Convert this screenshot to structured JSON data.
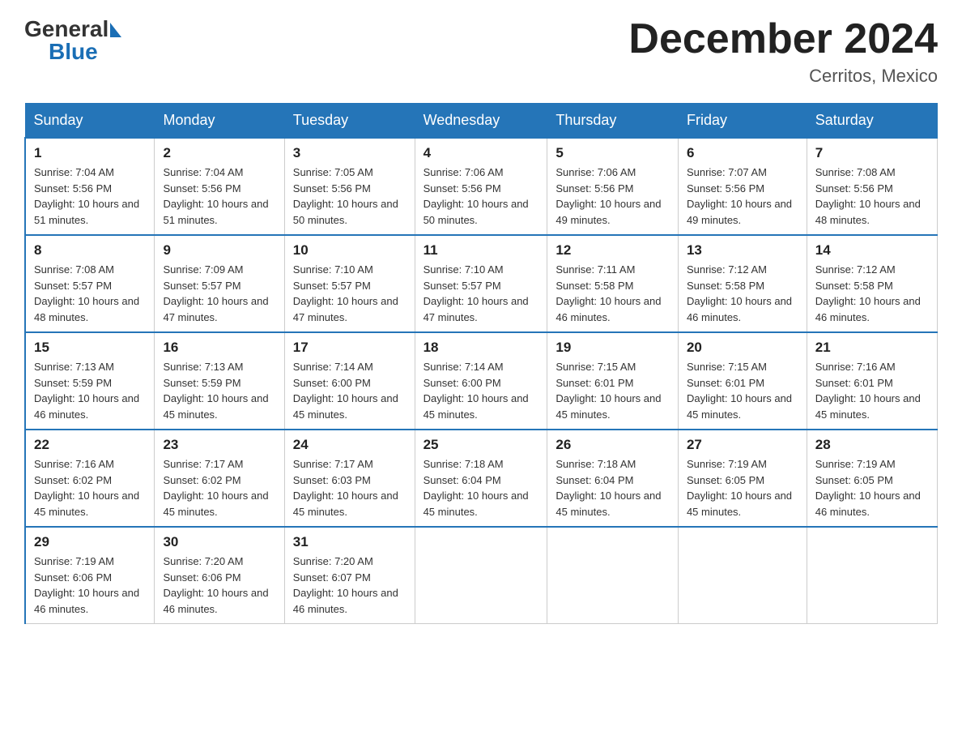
{
  "header": {
    "logo": {
      "general": "General",
      "blue": "Blue"
    },
    "title": "December 2024",
    "location": "Cerritos, Mexico"
  },
  "calendar": {
    "days_of_week": [
      "Sunday",
      "Monday",
      "Tuesday",
      "Wednesday",
      "Thursday",
      "Friday",
      "Saturday"
    ],
    "weeks": [
      [
        {
          "day": "1",
          "sunrise": "7:04 AM",
          "sunset": "5:56 PM",
          "daylight": "10 hours and 51 minutes."
        },
        {
          "day": "2",
          "sunrise": "7:04 AM",
          "sunset": "5:56 PM",
          "daylight": "10 hours and 51 minutes."
        },
        {
          "day": "3",
          "sunrise": "7:05 AM",
          "sunset": "5:56 PM",
          "daylight": "10 hours and 50 minutes."
        },
        {
          "day": "4",
          "sunrise": "7:06 AM",
          "sunset": "5:56 PM",
          "daylight": "10 hours and 50 minutes."
        },
        {
          "day": "5",
          "sunrise": "7:06 AM",
          "sunset": "5:56 PM",
          "daylight": "10 hours and 49 minutes."
        },
        {
          "day": "6",
          "sunrise": "7:07 AM",
          "sunset": "5:56 PM",
          "daylight": "10 hours and 49 minutes."
        },
        {
          "day": "7",
          "sunrise": "7:08 AM",
          "sunset": "5:56 PM",
          "daylight": "10 hours and 48 minutes."
        }
      ],
      [
        {
          "day": "8",
          "sunrise": "7:08 AM",
          "sunset": "5:57 PM",
          "daylight": "10 hours and 48 minutes."
        },
        {
          "day": "9",
          "sunrise": "7:09 AM",
          "sunset": "5:57 PM",
          "daylight": "10 hours and 47 minutes."
        },
        {
          "day": "10",
          "sunrise": "7:10 AM",
          "sunset": "5:57 PM",
          "daylight": "10 hours and 47 minutes."
        },
        {
          "day": "11",
          "sunrise": "7:10 AM",
          "sunset": "5:57 PM",
          "daylight": "10 hours and 47 minutes."
        },
        {
          "day": "12",
          "sunrise": "7:11 AM",
          "sunset": "5:58 PM",
          "daylight": "10 hours and 46 minutes."
        },
        {
          "day": "13",
          "sunrise": "7:12 AM",
          "sunset": "5:58 PM",
          "daylight": "10 hours and 46 minutes."
        },
        {
          "day": "14",
          "sunrise": "7:12 AM",
          "sunset": "5:58 PM",
          "daylight": "10 hours and 46 minutes."
        }
      ],
      [
        {
          "day": "15",
          "sunrise": "7:13 AM",
          "sunset": "5:59 PM",
          "daylight": "10 hours and 46 minutes."
        },
        {
          "day": "16",
          "sunrise": "7:13 AM",
          "sunset": "5:59 PM",
          "daylight": "10 hours and 45 minutes."
        },
        {
          "day": "17",
          "sunrise": "7:14 AM",
          "sunset": "6:00 PM",
          "daylight": "10 hours and 45 minutes."
        },
        {
          "day": "18",
          "sunrise": "7:14 AM",
          "sunset": "6:00 PM",
          "daylight": "10 hours and 45 minutes."
        },
        {
          "day": "19",
          "sunrise": "7:15 AM",
          "sunset": "6:01 PM",
          "daylight": "10 hours and 45 minutes."
        },
        {
          "day": "20",
          "sunrise": "7:15 AM",
          "sunset": "6:01 PM",
          "daylight": "10 hours and 45 minutes."
        },
        {
          "day": "21",
          "sunrise": "7:16 AM",
          "sunset": "6:01 PM",
          "daylight": "10 hours and 45 minutes."
        }
      ],
      [
        {
          "day": "22",
          "sunrise": "7:16 AM",
          "sunset": "6:02 PM",
          "daylight": "10 hours and 45 minutes."
        },
        {
          "day": "23",
          "sunrise": "7:17 AM",
          "sunset": "6:02 PM",
          "daylight": "10 hours and 45 minutes."
        },
        {
          "day": "24",
          "sunrise": "7:17 AM",
          "sunset": "6:03 PM",
          "daylight": "10 hours and 45 minutes."
        },
        {
          "day": "25",
          "sunrise": "7:18 AM",
          "sunset": "6:04 PM",
          "daylight": "10 hours and 45 minutes."
        },
        {
          "day": "26",
          "sunrise": "7:18 AM",
          "sunset": "6:04 PM",
          "daylight": "10 hours and 45 minutes."
        },
        {
          "day": "27",
          "sunrise": "7:19 AM",
          "sunset": "6:05 PM",
          "daylight": "10 hours and 45 minutes."
        },
        {
          "day": "28",
          "sunrise": "7:19 AM",
          "sunset": "6:05 PM",
          "daylight": "10 hours and 46 minutes."
        }
      ],
      [
        {
          "day": "29",
          "sunrise": "7:19 AM",
          "sunset": "6:06 PM",
          "daylight": "10 hours and 46 minutes."
        },
        {
          "day": "30",
          "sunrise": "7:20 AM",
          "sunset": "6:06 PM",
          "daylight": "10 hours and 46 minutes."
        },
        {
          "day": "31",
          "sunrise": "7:20 AM",
          "sunset": "6:07 PM",
          "daylight": "10 hours and 46 minutes."
        },
        null,
        null,
        null,
        null
      ]
    ]
  }
}
